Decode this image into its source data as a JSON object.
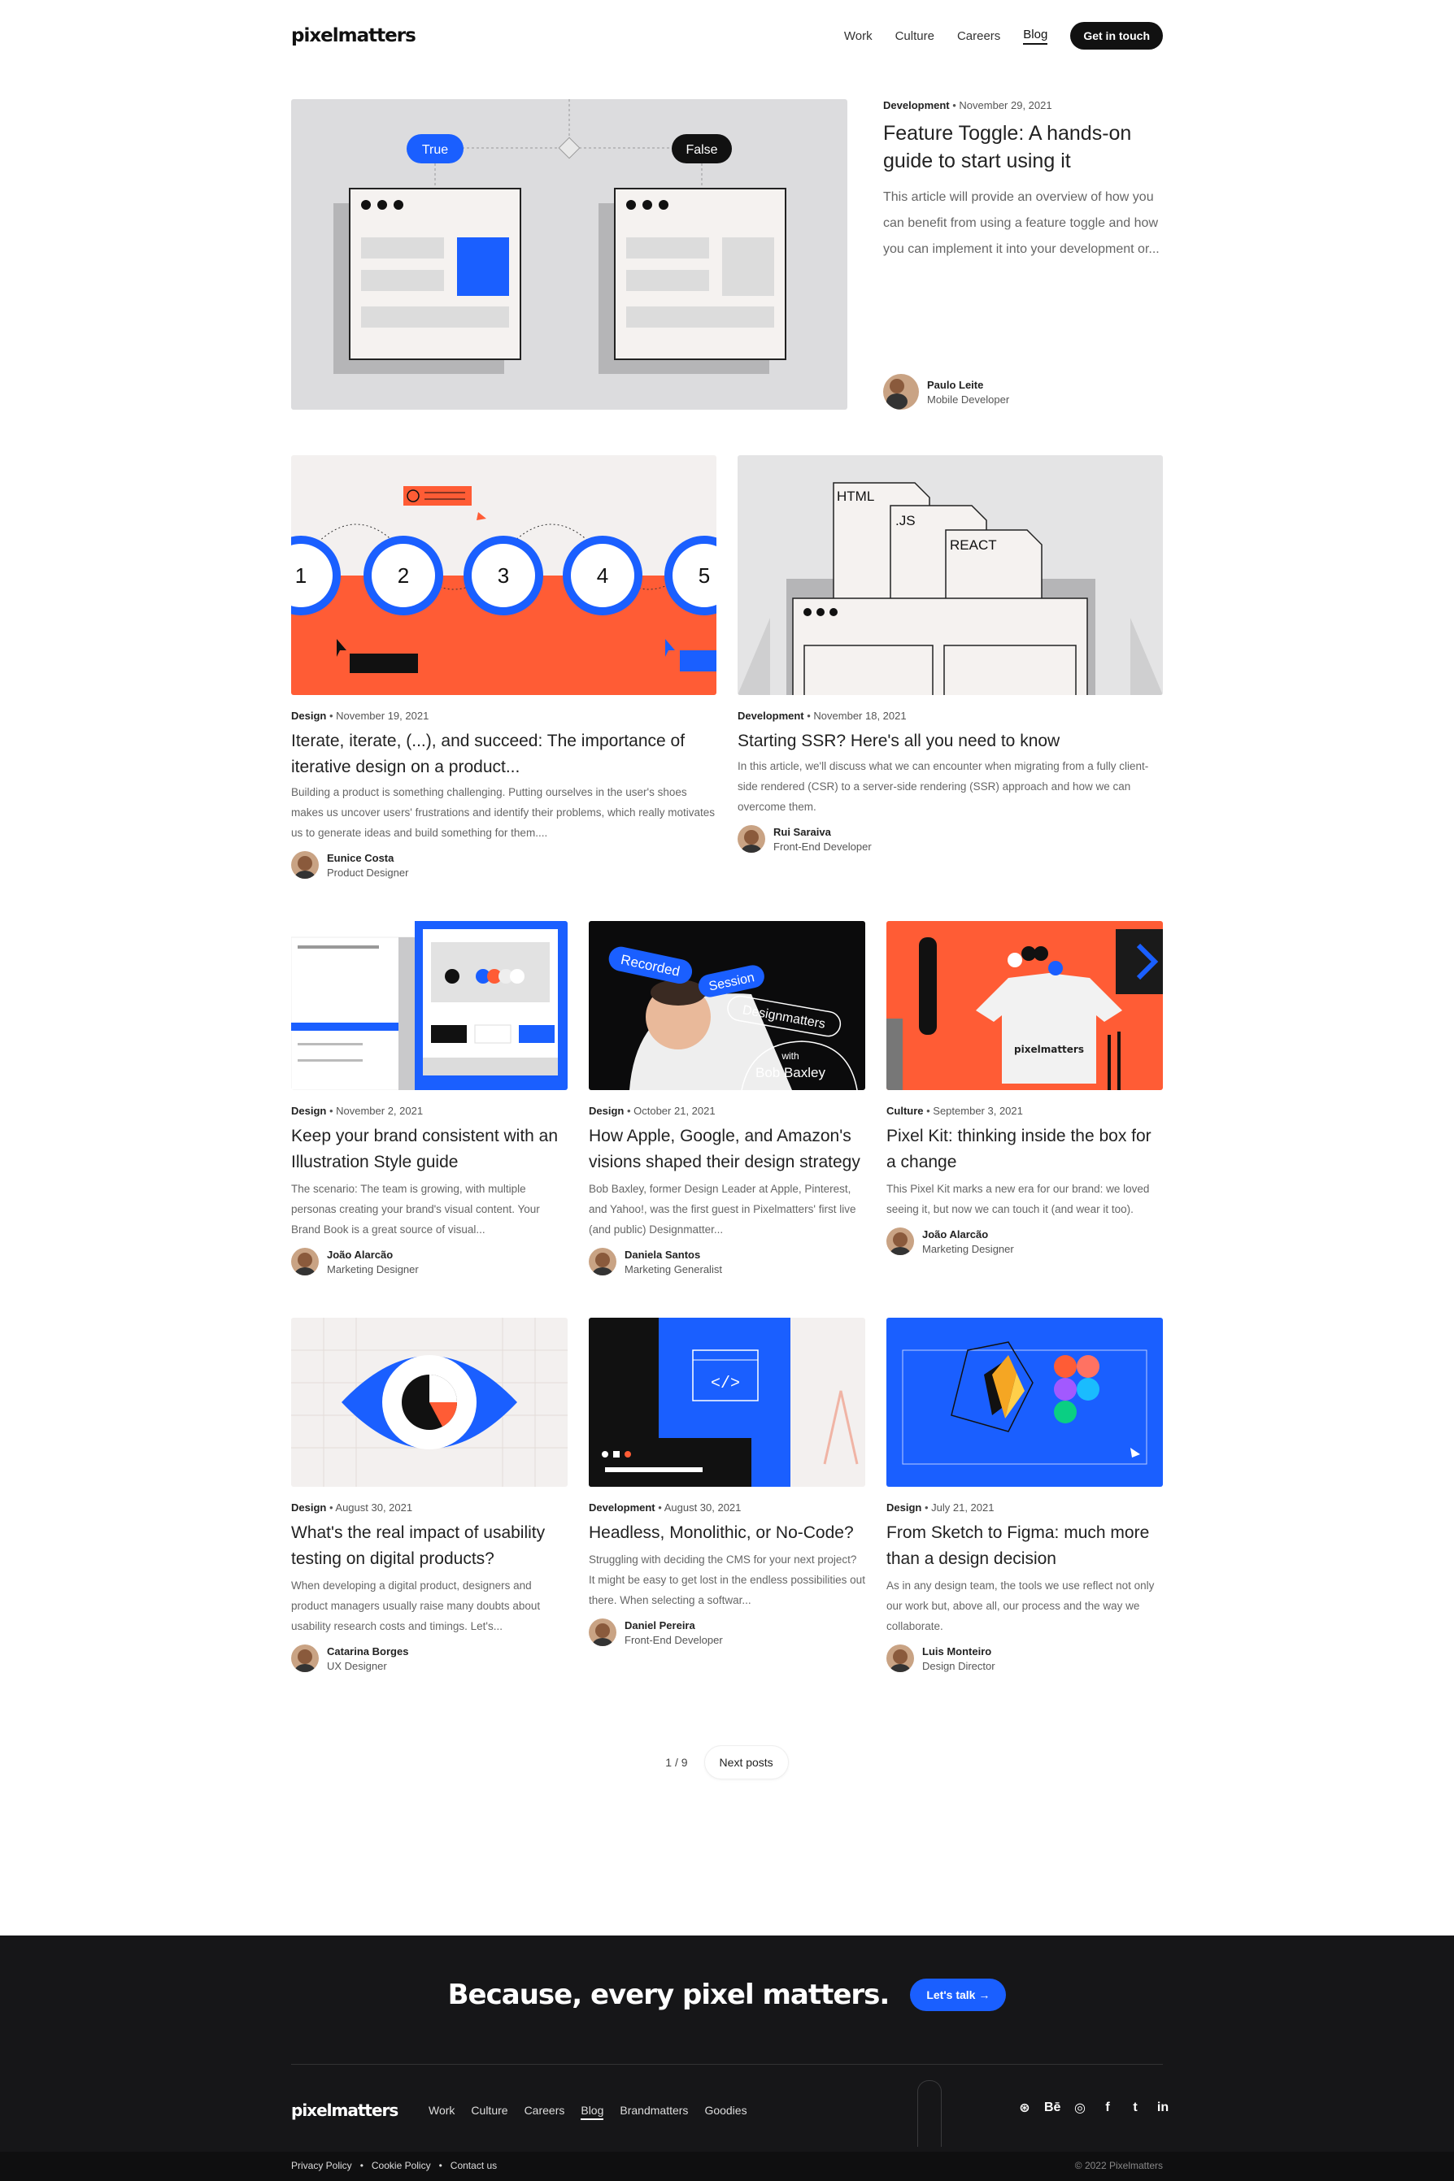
{
  "header": {
    "logo": "pixelmatters",
    "nav": [
      "Work",
      "Culture",
      "Careers",
      "Blog"
    ],
    "active": "Blog",
    "cta": "Get in touch"
  },
  "hero": {
    "category": "Development",
    "date": "November 29, 2021",
    "title": "Feature Toggle: A hands-on guide to start using it",
    "excerpt": "This article will provide an overview of how you can benefit from using a feature toggle and how you can implement it into your development or...",
    "author": "Paulo Leite",
    "role": "Mobile Developer",
    "img_true": "True",
    "img_false": "False"
  },
  "row2": [
    {
      "category": "Design",
      "date": "November 19, 2021",
      "title": "Iterate, iterate, (...), and succeed: The importance of iterative design on a product...",
      "excerpt": "Building a product is something challenging. Putting ourselves in the user's shoes makes us uncover users' frustrations and identify their problems, which really motivates us to generate ideas and build something for them....",
      "author": "Eunice Costa",
      "role": "Product Designer",
      "img_nums": [
        "1",
        "2",
        "3",
        "4",
        "5"
      ]
    },
    {
      "category": "Development",
      "date": "November 18, 2021",
      "title": "Starting SSR? Here's all you need to know",
      "excerpt": "In this article, we'll discuss what we can encounter when migrating from a fully client-side rendered (CSR) to a server-side rendering (SSR) approach and how we can overcome them.",
      "author": "Rui Saraiva",
      "role": "Front-End Developer",
      "img_labels": [
        "HTML",
        ".JS",
        "REACT"
      ]
    }
  ],
  "row3": [
    {
      "category": "Design",
      "date": "November 2, 2021",
      "title": "Keep your brand consistent with an Illustration Style guide",
      "excerpt": "The scenario: The team is growing, with multiple personas creating your brand's visual content. Your Brand Book is a great source of visual...",
      "author": "João Alarcão",
      "role": "Marketing Designer"
    },
    {
      "category": "Design",
      "date": "October 21, 2021",
      "title": "How Apple, Google, and Amazon's visions shaped their design strategy",
      "excerpt": "Bob Baxley, former Design Leader at Apple, Pinterest, and Yahoo!, was the first guest in Pixelmatters' first live (and public) Designmatter...",
      "author": "Daniela Santos",
      "role": "Marketing Generalist",
      "img_tags": [
        "Recorded",
        "Session",
        "Designmatters",
        "with",
        "Bob Baxley"
      ]
    },
    {
      "category": "Culture",
      "date": "September 3, 2021",
      "title": "Pixel Kit: thinking inside the box for a change",
      "excerpt": "This Pixel Kit marks a new era for our brand: we loved seeing it, but now we can touch it (and wear it too).",
      "author": "João Alarcão",
      "role": "Marketing Designer",
      "img_shirt": "pixelmatters"
    }
  ],
  "row4": [
    {
      "category": "Design",
      "date": "August 30, 2021",
      "title": "What's the real impact of usability testing on digital products?",
      "excerpt": "When developing a digital product, designers and product managers usually raise many doubts about usability research costs and timings. Let's...",
      "author": "Catarina Borges",
      "role": "UX Designer"
    },
    {
      "category": "Development",
      "date": "August 30, 2021",
      "title": "Headless, Monolithic, or No-Code?",
      "excerpt": "Struggling with deciding the CMS for your next project? It might be easy to get lost in the endless possibilities out there. When selecting a softwar...",
      "author": "Daniel Pereira",
      "role": "Front-End Developer",
      "img_code": "</>"
    },
    {
      "category": "Design",
      "date": "July 21, 2021",
      "title": "From Sketch to Figma: much more than a design decision",
      "excerpt": "As in any design team, the tools we use reflect not only our work but, above all, our process and the way we collaborate.",
      "author": "Luis Monteiro",
      "role": "Design Director"
    }
  ],
  "pager": {
    "page": "1 / 9",
    "next": "Next posts"
  },
  "footer": {
    "tagline": "Because, every pixel matters.",
    "cta": "Let's talk →",
    "logo": "pixelmatters",
    "nav": [
      "Work",
      "Culture",
      "Careers",
      "Blog",
      "Brandmatters",
      "Goodies"
    ],
    "social": [
      "dribbble-icon",
      "behance-icon",
      "instagram-icon",
      "facebook-icon",
      "twitter-icon",
      "linkedin-icon"
    ],
    "social_glyphs": [
      "⊛",
      "Bē",
      "◎",
      "f",
      "t",
      "in"
    ],
    "legal": [
      "Privacy Policy",
      "•",
      "Cookie Policy",
      "•",
      "Contact us"
    ],
    "copyright": "© 2022 Pixelmatters"
  },
  "colors": {
    "accent_blue": "#1a5fff",
    "orange": "#ff5c35",
    "dark": "#161618"
  }
}
